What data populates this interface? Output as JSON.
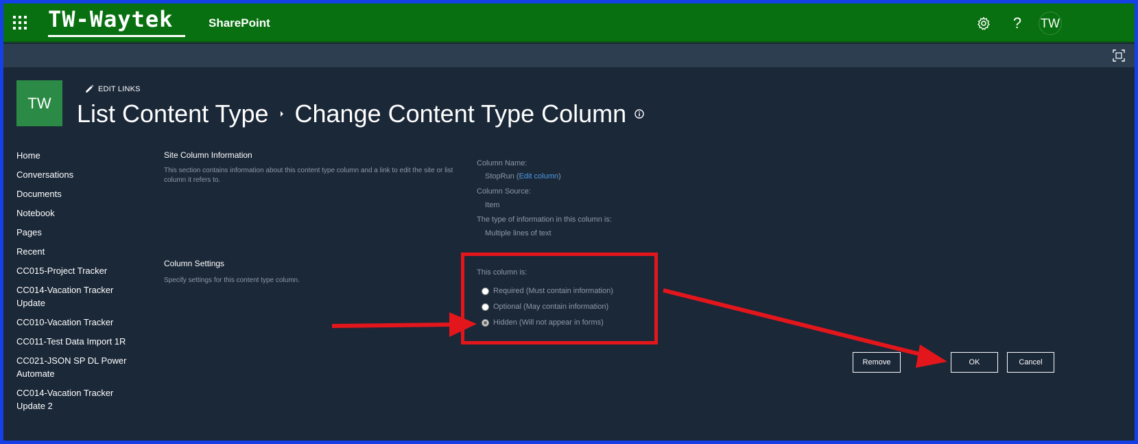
{
  "suite_bar": {
    "logo_text": "TW-Waytek",
    "app_name": "SharePoint",
    "help_glyph": "?",
    "avatar_initials": "TW"
  },
  "site": {
    "logo_initials": "TW",
    "edit_links_label": "EDIT LINKS",
    "breadcrumb": [
      "List Content Type",
      "Change Content Type Column"
    ]
  },
  "left_nav": {
    "items": [
      "Home",
      "Conversations",
      "Documents",
      "Notebook",
      "Pages",
      "Recent",
      "CC015-Project Tracker",
      "CC014-Vacation Tracker Update",
      "CC010-Vacation Tracker",
      "CC011-Test Data Import 1R",
      "CC021-JSON SP DL Power Automate",
      "CC014-Vacation Tracker Update 2"
    ]
  },
  "site_column_info": {
    "title": "Site Column Information",
    "description": "This section contains information about this content type column and a link to edit the site or list column it refers to.",
    "column_name_label": "Column Name:",
    "column_name_value": "StopRun",
    "edit_column_link": "Edit column",
    "column_source_label": "Column Source:",
    "column_source_value": "Item",
    "type_label": "The type of information in this column is:",
    "type_value": "Multiple lines of text"
  },
  "column_settings": {
    "title": "Column Settings",
    "description": "Specify settings for this content type column.",
    "prompt": "This column is:",
    "options": [
      "Required (Must contain information)",
      "Optional (May contain information)",
      "Hidden (Will not appear in forms)"
    ],
    "selected_index": 2
  },
  "buttons": {
    "remove": "Remove",
    "ok": "OK",
    "cancel": "Cancel"
  },
  "colors": {
    "suite_bar": "#087010",
    "page_background": "#1b2838",
    "annotation_red": "#e3161c",
    "outer_border": "#1540e8"
  },
  "icons": {
    "waffle": "app-launcher-icon",
    "settings": "gear-icon",
    "focus": "focus-mode-icon",
    "edit": "pencil-icon",
    "info": "info-icon"
  }
}
